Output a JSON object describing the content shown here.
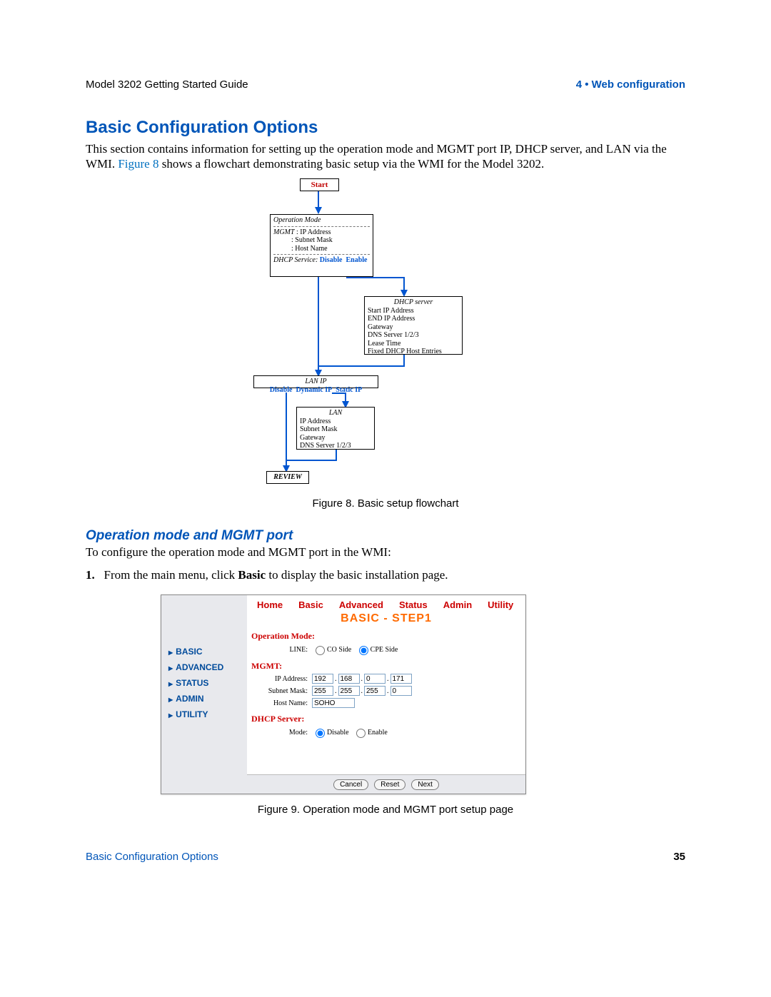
{
  "header": {
    "left": "Model 3202 Getting Started Guide",
    "right": "4 • Web configuration"
  },
  "h1": "Basic Configuration Options",
  "para1_a": "This section contains information for setting up the operation mode and MGMT port IP, DHCP server, and LAN via the WMI. ",
  "para1_link": "Figure 8",
  "para1_b": " shows a flowchart demonstrating basic setup via the WMI for the Model 3202.",
  "flowchart": {
    "start": "Start",
    "op_title": "Operation Mode",
    "op_mgmt": "MGMT",
    "op_ip": "IP Address",
    "op_subnet": "Subnet Mask",
    "op_host": "Host Name",
    "op_dhcp_label": "DHCP Service:",
    "disable": "Disable",
    "enable": "Enable",
    "dhcp_title": "DHCP server",
    "dhcp_l1": "Start IP Address",
    "dhcp_l2": "END IP Address",
    "dhcp_l3": "Gateway",
    "dhcp_l4": "DNS Server 1/2/3",
    "dhcp_l5": "Lease Time",
    "dhcp_l6": "Fixed DHCP Host Entries",
    "lan_title": "LAN IP",
    "dynip": "Dynamic IP",
    "staticip": "Static IP",
    "lan2_title": "LAN",
    "lan2_l1": "IP Address",
    "lan2_l2": "Subnet Mask",
    "lan2_l3": "Gateway",
    "lan2_l4": "DNS Server 1/2/3",
    "review": "REVIEW"
  },
  "caption1": "Figure 8. Basic setup flowchart",
  "h2": "Operation mode and MGMT port",
  "para2": "To configure the operation mode and MGMT port in the WMI:",
  "step1_num": "1.",
  "step1_a": "From the main menu, click ",
  "step1_bold": "Basic",
  "step1_b": " to display the basic installation page.",
  "sidebar": {
    "items": [
      "BASIC",
      "ADVANCED",
      "STATUS",
      "ADMIN",
      "UTILITY"
    ]
  },
  "tabs": [
    "Home",
    "Basic",
    "Advanced",
    "Status",
    "Admin",
    "Utility"
  ],
  "pageTitle": "BASIC - STEP1",
  "shot": {
    "opmode": "Operation Mode:",
    "line": "LINE:",
    "coside": "CO Side",
    "cpeside": "CPE Side",
    "mgmt": "MGMT:",
    "ipaddr_label": "IP Address:",
    "ip": [
      "192",
      "168",
      "0",
      "171"
    ],
    "subnet_label": "Subnet Mask:",
    "subnet": [
      "255",
      "255",
      "255",
      "0"
    ],
    "hostname_label": "Host Name:",
    "hostname": "SOHO",
    "dhcp": "DHCP Server:",
    "mode": "Mode:",
    "disable": "Disable",
    "enable": "Enable",
    "buttons": {
      "cancel": "Cancel",
      "reset": "Reset",
      "next": "Next"
    }
  },
  "caption2": "Figure 9. Operation mode and MGMT port setup page",
  "footer": {
    "left": "Basic Configuration Options",
    "right": "35"
  }
}
